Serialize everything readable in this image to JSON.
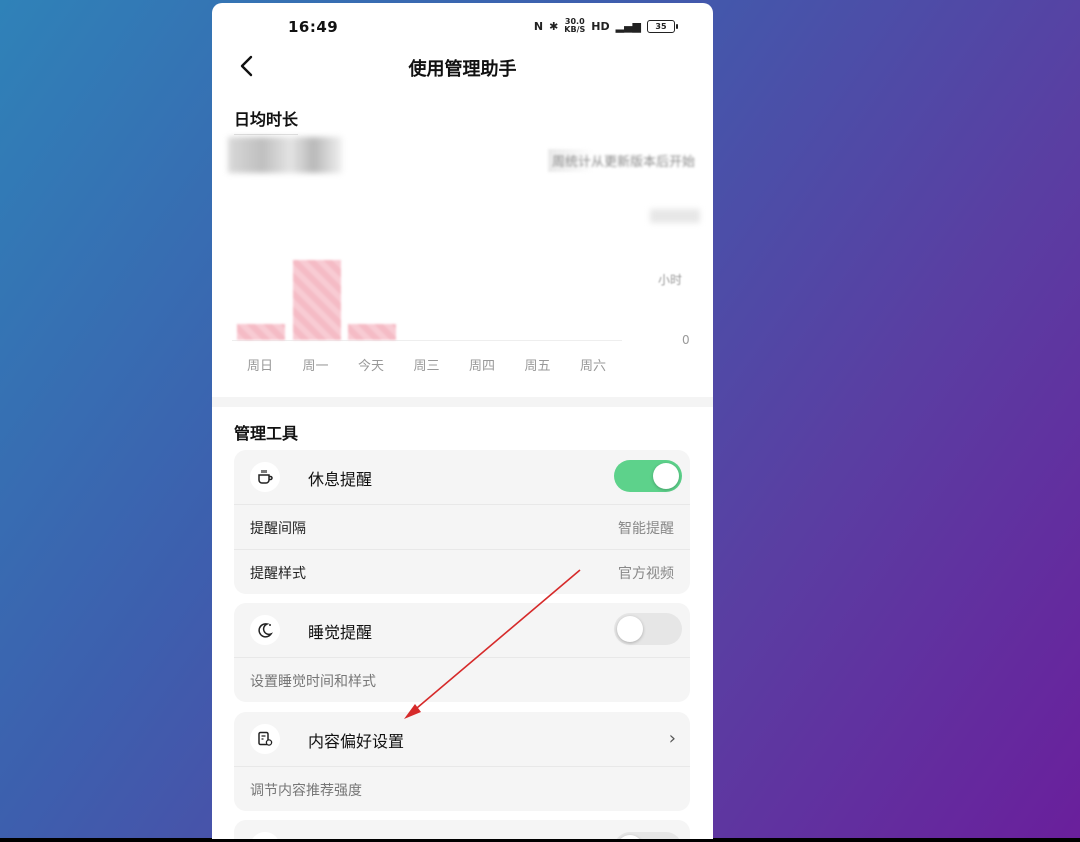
{
  "status": {
    "time": "16:49",
    "speed": "30.0",
    "speed_unit": "KB/S",
    "battery": "35"
  },
  "header": {
    "title": "使用管理助手"
  },
  "daily": {
    "title": "日均时长",
    "note": "周统计从更新版本后开始",
    "y_mid_label": "小时",
    "y_zero_label": "0"
  },
  "chart_data": {
    "type": "bar",
    "categories": [
      "周日",
      "周一",
      "今天",
      "周三",
      "周四",
      "周五",
      "周六"
    ],
    "ylabel": "小时",
    "values": [
      0.2,
      1.0,
      0.2,
      0,
      0,
      0,
      0
    ],
    "colors": {
      "bar": "#f6bcc6"
    }
  },
  "tools": {
    "title": "管理工具",
    "rest": {
      "title": "休息提醒",
      "toggle_on": true,
      "rows": [
        {
          "label": "提醒间隔",
          "value": "智能提醒"
        },
        {
          "label": "提醒样式",
          "value": "官方视频"
        }
      ]
    },
    "sleep": {
      "title": "睡觉提醒",
      "toggle_on": false,
      "desc": "设置睡觉时间和样式"
    },
    "content": {
      "title": "内容偏好设置",
      "desc": "调节内容推荐强度"
    }
  },
  "colors": {
    "accent": "#5dd28b",
    "annotation_arrow": "#d62a2a"
  }
}
